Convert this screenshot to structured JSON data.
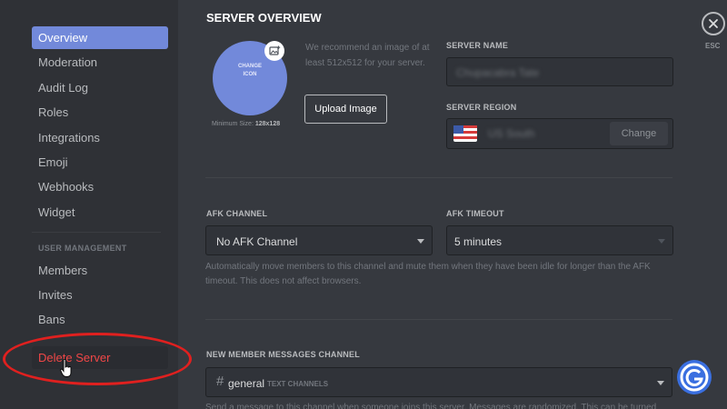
{
  "sidebar": {
    "items": [
      {
        "label": "Overview"
      },
      {
        "label": "Moderation"
      },
      {
        "label": "Audit Log"
      },
      {
        "label": "Roles"
      },
      {
        "label": "Integrations"
      },
      {
        "label": "Emoji"
      },
      {
        "label": "Webhooks"
      },
      {
        "label": "Widget"
      }
    ],
    "user_management_header": "USER MANAGEMENT",
    "user_items": [
      {
        "label": "Members"
      },
      {
        "label": "Invites"
      },
      {
        "label": "Bans"
      }
    ],
    "delete_label": "Delete Server"
  },
  "overview": {
    "title": "SERVER OVERVIEW",
    "icon_text_line1": "CHANGE",
    "icon_text_line2": "ICON",
    "recommend_text": "We recommend an image of at least 512x512 for your server.",
    "upload_label": "Upload Image",
    "min_size_label": "Minimum Size:",
    "min_size_value": "128x128"
  },
  "server_name": {
    "label": "SERVER NAME",
    "value": "Chupacabra Tate"
  },
  "server_region": {
    "label": "SERVER REGION",
    "value": "US South",
    "change_label": "Change"
  },
  "afk": {
    "channel_label": "AFK CHANNEL",
    "channel_value": "No AFK Channel",
    "timeout_label": "AFK TIMEOUT",
    "timeout_value": "5 minutes",
    "description": "Automatically move members to this channel and mute them when they have been idle for longer than the AFK timeout. This does not affect browsers."
  },
  "new_member": {
    "label": "NEW MEMBER MESSAGES CHANNEL",
    "channel_value": "general",
    "channel_hint": "TEXT CHANNELS",
    "description": "Send a message to this channel when someone joins this server. Messages are randomized. This can be turned"
  },
  "close": {
    "esc_label": "ESC"
  },
  "icons": {
    "close": "close-icon",
    "upload": "image-upload-icon",
    "flag": "us-flag-icon",
    "cursor": "hand-cursor-icon",
    "watermark": "gp-logo-icon"
  },
  "colors": {
    "accent": "#7289da",
    "danger": "#f04747",
    "annotation": "#e0201f",
    "background": "#36393f",
    "sidebar": "#2f3136"
  }
}
